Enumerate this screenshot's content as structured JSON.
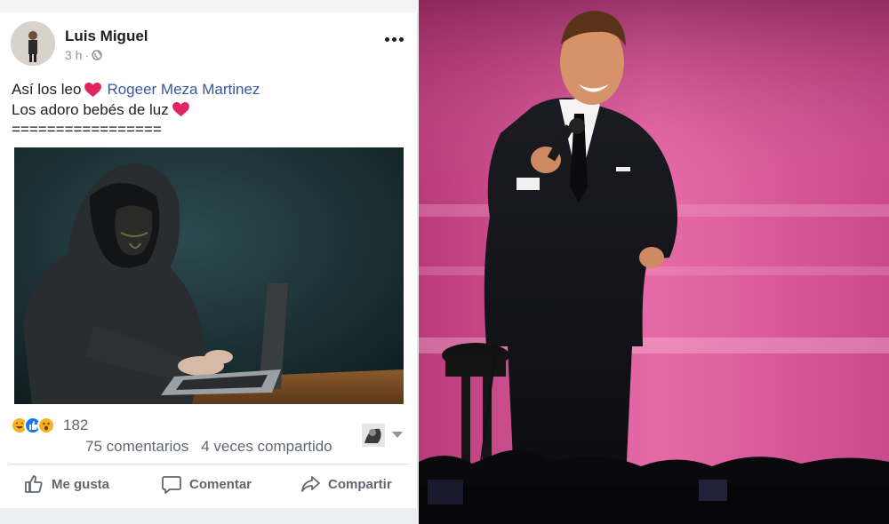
{
  "post": {
    "author": "Luis Miguel",
    "time": "3 h",
    "separator": "·",
    "text_line1": "Así los leo",
    "mention": "Rogeer Meza Martinez",
    "text_line2": "Los adoro bebés de luz",
    "text_line3": "=================",
    "reactions": {
      "icons": [
        "laugh-icon",
        "like-icon",
        "wow-icon"
      ],
      "count": "182"
    },
    "comments": "75 comentarios",
    "shares": "4 veces compartido",
    "actions": {
      "like": "Me gusta",
      "comment": "Comentar",
      "share": "Compartir"
    }
  },
  "colors": {
    "facebook_link": "#385898",
    "text_primary": "#1c1e21",
    "text_secondary": "#606770",
    "heart": "#e0245e",
    "like_blue": "#1877f2",
    "stage_pink": "#d0588f"
  }
}
